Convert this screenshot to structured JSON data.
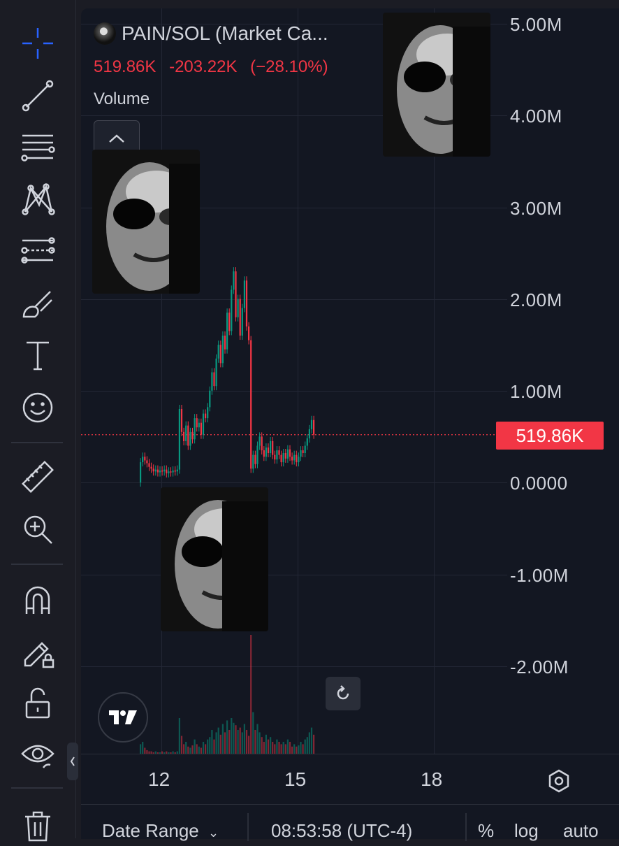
{
  "symbol": {
    "title": "PAIN/SOL (Market Ca...",
    "last": "519.86K",
    "change": "-203.22K",
    "change_pct": "(−28.10%)",
    "volume_label": "Volume"
  },
  "price_axis": {
    "labels": [
      "5.00M",
      "4.00M",
      "3.00M",
      "2.00M",
      "1.00M",
      "0.0000",
      "-1.00M",
      "-2.00M"
    ],
    "current_tag": "519.86K"
  },
  "time_axis": {
    "labels": [
      "12",
      "15",
      "18"
    ]
  },
  "bottom_bar": {
    "date_range": "Date Range",
    "clock": "08:53:58 (UTC-4)",
    "percent": "%",
    "log": "log",
    "auto": "auto"
  },
  "colors": {
    "up": "#089981",
    "down": "#f23645",
    "background": "#131722",
    "accent": "#2962ff"
  },
  "toolbar_icons": [
    "crosshair-icon",
    "trend-line-icon",
    "fib-retracement-icon",
    "pattern-icon",
    "prediction-icon",
    "brush-icon",
    "text-icon",
    "emoji-icon",
    "ruler-icon",
    "zoom-in-icon",
    "magnet-icon",
    "lock-drawing-icon",
    "lock-icon",
    "eye-icon",
    "trash-icon"
  ],
  "chart_data": {
    "type": "candlestick",
    "title": "PAIN/SOL (Market Ca...",
    "ylim": [
      -2500000,
      5200000
    ],
    "x_ticks": [
      "12",
      "15",
      "18"
    ],
    "last_value": 519860,
    "candles": [
      [
        0.0,
        0.22
      ],
      [
        0.22,
        0.28
      ],
      [
        0.28,
        0.24
      ],
      [
        0.24,
        0.21
      ],
      [
        0.21,
        0.17
      ],
      [
        0.17,
        0.15
      ],
      [
        0.15,
        0.12
      ],
      [
        0.12,
        0.14
      ],
      [
        0.14,
        0.11
      ],
      [
        0.11,
        0.13
      ],
      [
        0.13,
        0.12
      ],
      [
        0.12,
        0.14
      ],
      [
        0.14,
        0.1
      ],
      [
        0.1,
        0.12
      ],
      [
        0.12,
        0.11
      ],
      [
        0.11,
        0.13
      ],
      [
        0.13,
        0.12
      ],
      [
        0.12,
        0.14
      ],
      [
        0.14,
        0.8
      ],
      [
        0.8,
        0.55
      ],
      [
        0.55,
        0.45
      ],
      [
        0.45,
        0.62
      ],
      [
        0.62,
        0.4
      ],
      [
        0.4,
        0.55
      ],
      [
        0.55,
        0.47
      ],
      [
        0.47,
        0.7
      ],
      [
        0.7,
        0.6
      ],
      [
        0.6,
        0.65
      ],
      [
        0.65,
        0.52
      ],
      [
        0.52,
        0.75
      ],
      [
        0.75,
        0.7
      ],
      [
        0.7,
        0.82
      ],
      [
        0.82,
        1.0
      ],
      [
        1.0,
        1.2
      ],
      [
        1.2,
        1.05
      ],
      [
        1.05,
        1.35
      ],
      [
        1.35,
        1.5
      ],
      [
        1.5,
        1.3
      ],
      [
        1.3,
        1.6
      ],
      [
        1.6,
        1.45
      ],
      [
        1.45,
        1.85
      ],
      [
        1.85,
        1.65
      ],
      [
        1.65,
        2.1
      ],
      [
        2.1,
        2.3
      ],
      [
        2.3,
        1.8
      ],
      [
        1.8,
        2.0
      ],
      [
        2.0,
        1.6
      ],
      [
        1.6,
        1.9
      ],
      [
        1.9,
        2.2
      ],
      [
        2.2,
        1.7
      ],
      [
        1.7,
        1.55
      ],
      [
        1.55,
        0.15
      ],
      [
        0.15,
        0.3
      ],
      [
        0.3,
        0.2
      ],
      [
        0.2,
        0.4
      ],
      [
        0.4,
        0.5
      ],
      [
        0.5,
        0.35
      ],
      [
        0.35,
        0.28
      ],
      [
        0.28,
        0.38
      ],
      [
        0.38,
        0.32
      ],
      [
        0.32,
        0.45
      ],
      [
        0.45,
        0.3
      ],
      [
        0.3,
        0.25
      ],
      [
        0.25,
        0.35
      ],
      [
        0.35,
        0.3
      ],
      [
        0.3,
        0.22
      ],
      [
        0.22,
        0.32
      ],
      [
        0.32,
        0.26
      ],
      [
        0.26,
        0.36
      ],
      [
        0.36,
        0.28
      ],
      [
        0.28,
        0.24
      ],
      [
        0.24,
        0.3
      ],
      [
        0.3,
        0.22
      ],
      [
        0.22,
        0.28
      ],
      [
        0.28,
        0.35
      ],
      [
        0.35,
        0.32
      ],
      [
        0.32,
        0.4
      ],
      [
        0.4,
        0.48
      ],
      [
        0.48,
        0.58
      ],
      [
        0.58,
        0.68
      ],
      [
        0.68,
        0.52
      ]
    ],
    "volumes": [
      0.08,
      0.1,
      0.05,
      0.03,
      0.02,
      0.02,
      0.01,
      0.02,
      0.01,
      0.01,
      0.02,
      0.01,
      0.02,
      0.01,
      0.01,
      0.02,
      0.01,
      0.02,
      0.3,
      0.15,
      0.08,
      0.1,
      0.06,
      0.05,
      0.07,
      0.12,
      0.08,
      0.06,
      0.05,
      0.1,
      0.08,
      0.12,
      0.14,
      0.2,
      0.12,
      0.18,
      0.22,
      0.16,
      0.25,
      0.18,
      0.28,
      0.2,
      0.3,
      0.26,
      0.24,
      0.2,
      0.22,
      0.18,
      0.25,
      0.2,
      0.15,
      1.0,
      0.35,
      0.2,
      0.25,
      0.18,
      0.14,
      0.1,
      0.16,
      0.12,
      0.14,
      0.1,
      0.08,
      0.12,
      0.1,
      0.08,
      0.1,
      0.08,
      0.12,
      0.1,
      0.06,
      0.08,
      0.06,
      0.07,
      0.1,
      0.08,
      0.12,
      0.14,
      0.18,
      0.22,
      0.16
    ]
  }
}
